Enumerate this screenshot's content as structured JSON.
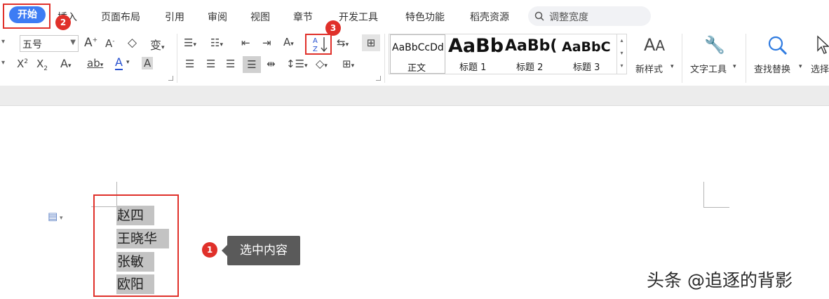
{
  "tabs": {
    "active": "开始",
    "items": [
      "插入",
      "页面布局",
      "引用",
      "审阅",
      "视图",
      "章节",
      "开发工具",
      "特色功能",
      "稻壳资源"
    ]
  },
  "search": {
    "placeholder": "调整宽度"
  },
  "font": {
    "size": "五号"
  },
  "styles": {
    "items": [
      {
        "sample": "AaBbCcDd",
        "name": "正文"
      },
      {
        "sample": "AaBb",
        "name": "标题 1"
      },
      {
        "sample": "AaBb(",
        "name": "标题 2"
      },
      {
        "sample": "AaBbC",
        "name": "标题 3"
      }
    ]
  },
  "buttons": {
    "new_style": "新样式",
    "text_tools": "文字工具",
    "find_replace": "查找替换",
    "select": "选择"
  },
  "document": {
    "lines": [
      "赵四",
      "王晓华",
      "张敏",
      "欧阳"
    ]
  },
  "annotations": {
    "badge1": "1",
    "badge2": "2",
    "badge3": "3",
    "callout": "选中内容"
  },
  "watermark": "头条 @追逐的背影",
  "colors": {
    "accent": "#3d7cf4",
    "highlight_red": "#e0302a",
    "selection": "#c3c3c3",
    "callout_bg": "#5a5a5a"
  }
}
